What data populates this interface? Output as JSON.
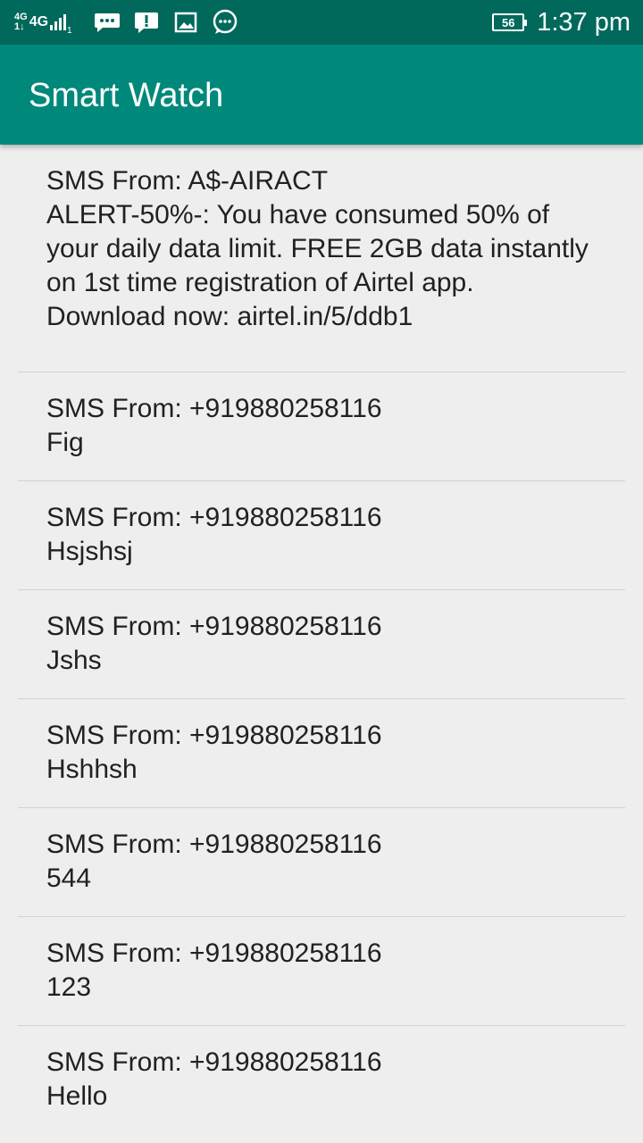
{
  "status_bar": {
    "network_small_top": "4G",
    "network_small_bottom": "1↓",
    "network_label": "4G",
    "sim_index": "1",
    "battery_level": "56",
    "time": "1:37 pm",
    "icons": [
      "chat-bubble-icon",
      "message-alert-icon",
      "image-icon",
      "more-chat-icon"
    ]
  },
  "app_bar": {
    "title": "Smart Watch"
  },
  "messages": [
    {
      "from": "SMS From: A$-AIRACT",
      "body": "ALERT-50%-: You have consumed 50% of your daily data limit. FREE 2GB data instantly on 1st time registration of Airtel app. Download now: airtel.in/5/ddb1"
    },
    {
      "from": "SMS From: +919880258116",
      "body": "Fig"
    },
    {
      "from": "SMS From: +919880258116",
      "body": "Hsjshsj"
    },
    {
      "from": "SMS From: +919880258116",
      "body": "Jshs"
    },
    {
      "from": "SMS From: +919880258116",
      "body": "Hshhsh"
    },
    {
      "from": "SMS From: +919880258116",
      "body": "544"
    },
    {
      "from": "SMS From: +919880258116",
      "body": "123"
    },
    {
      "from": "SMS From: +919880258116",
      "body": "Hello"
    }
  ],
  "colors": {
    "status_bar": "#00695c",
    "app_bar": "#00897b",
    "background": "#eeeeee"
  }
}
